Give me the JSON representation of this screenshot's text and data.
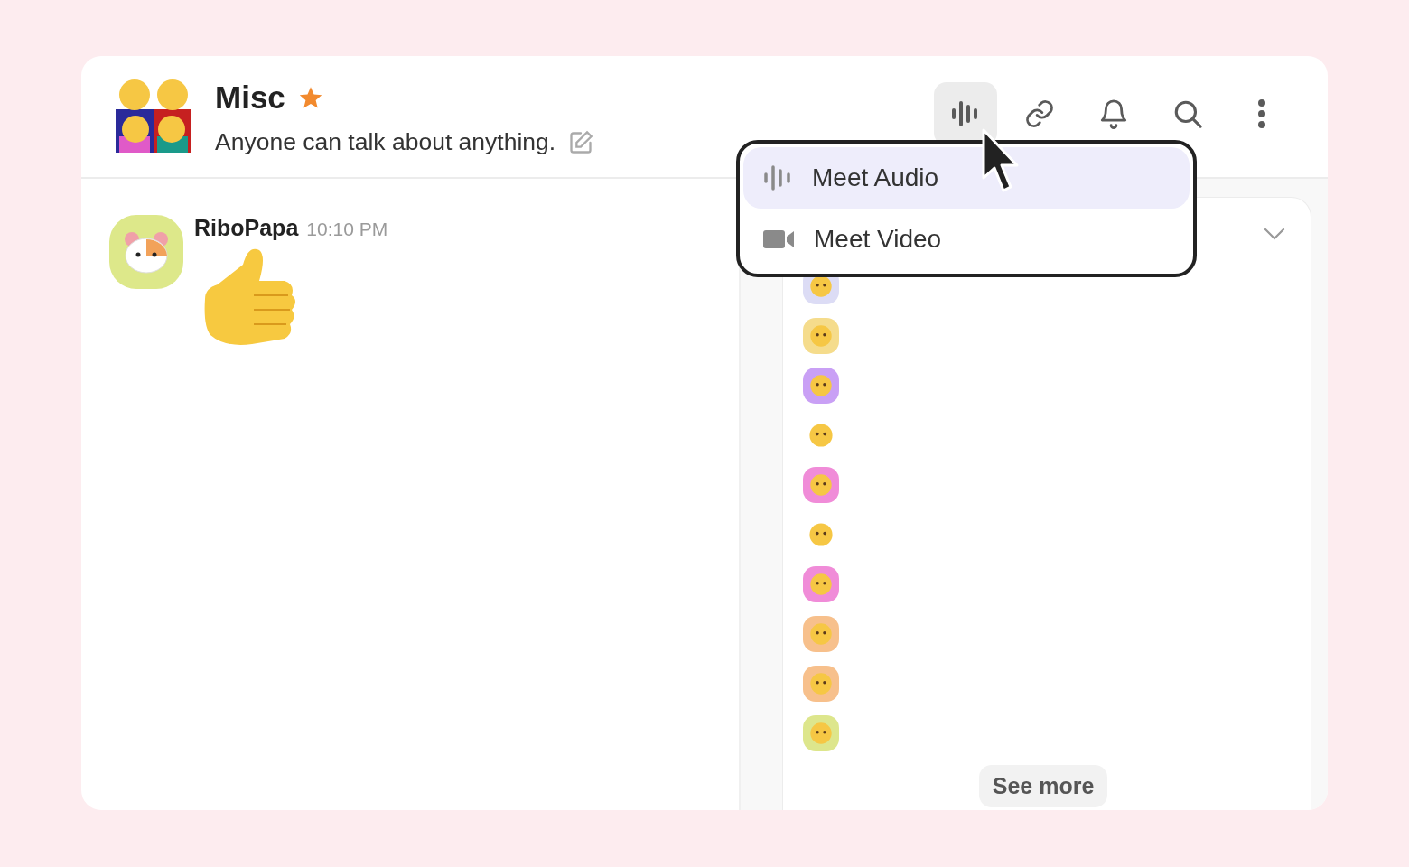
{
  "channel": {
    "title": "Misc",
    "starred": true,
    "description": "Anyone can talk about anything."
  },
  "toolbar": [
    {
      "kind": "audio",
      "selected": true
    },
    {
      "kind": "link",
      "selected": false
    },
    {
      "kind": "bell",
      "selected": false
    },
    {
      "kind": "search",
      "selected": false
    },
    {
      "kind": "more",
      "selected": false
    }
  ],
  "call_menu": {
    "items": [
      {
        "kind": "audio",
        "label": "Meet Audio",
        "selected": true
      },
      {
        "kind": "video",
        "label": "Meet Video",
        "selected": false
      }
    ]
  },
  "messages": [
    {
      "author": "RiboPapa",
      "time": "10:10 PM"
    }
  ],
  "members": [
    {
      "kind": "badge",
      "color": "#dcdcf5"
    },
    {
      "kind": "badge",
      "color": "#f5dc8c"
    },
    {
      "kind": "badge",
      "color": "#c9a0f5"
    },
    {
      "kind": "plain"
    },
    {
      "kind": "badge",
      "color": "#f08cd8"
    },
    {
      "kind": "plain"
    },
    {
      "kind": "badge",
      "color": "#f08cd8"
    },
    {
      "kind": "badge",
      "color": "#f7c08c"
    },
    {
      "kind": "badge",
      "color": "#f7c08c"
    },
    {
      "kind": "badge",
      "color": "#dde68c"
    }
  ],
  "see_more": "See more"
}
